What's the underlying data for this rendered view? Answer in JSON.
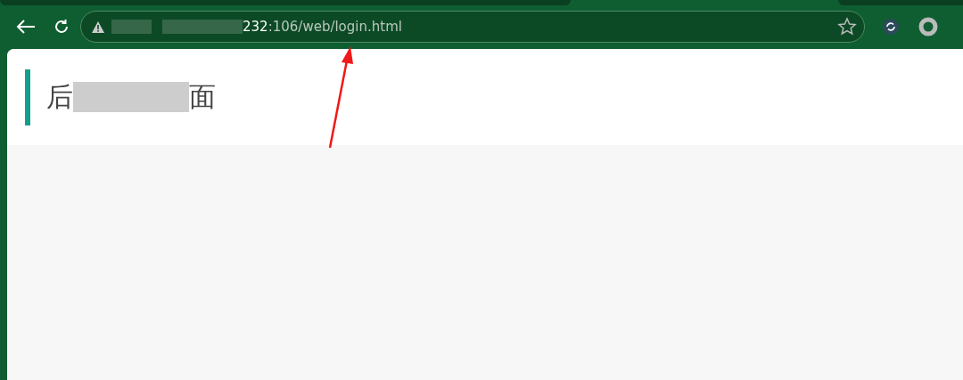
{
  "browser": {
    "address_host_end": "232",
    "address_path": ":106/web/login.html"
  },
  "page": {
    "title_start": "后",
    "title_end": "面"
  }
}
